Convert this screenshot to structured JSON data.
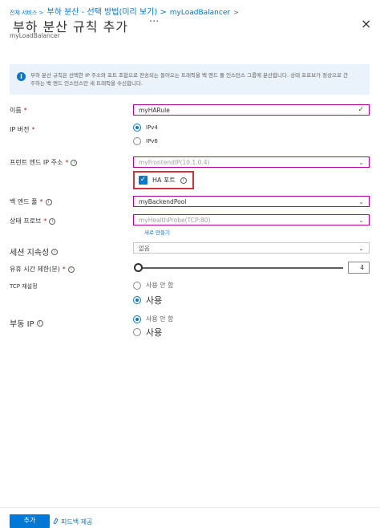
{
  "breadcrumb": {
    "items": [
      "전체 서비스 >",
      "부하 분산 - 선택 방법(미리 보기) >",
      "myLoadBalancer"
    ],
    "trailing_separator": ">"
  },
  "header": {
    "title": "부하 분산 규칙 추가",
    "more_label": "···",
    "close_label": "×",
    "subtitle": "myLoadBalancer"
  },
  "info": {
    "icon": "info-icon",
    "glyph": "i",
    "text": "부하 분산 규칙은 선택한 IP 주소와 포트 조합으로 전송되는 들어오는 트래픽을 백 엔드 풀 인스턴스 그룹에 분산합니다. 상태 프로브가 정상으로 간주하는 백 엔드 인스턴스만 새 트래픽을 수신합니다."
  },
  "form": {
    "name": {
      "label": "이름",
      "required_mark": "*",
      "value": "myHARule",
      "valid_mark": "✓"
    },
    "ip_version": {
      "label": "IP 버전",
      "required_mark": "*",
      "options": [
        "IPv4",
        "IPv6"
      ],
      "selected": "IPv4"
    },
    "frontend_ip": {
      "label": "프런트 엔드 IP 주소",
      "required_mark": "*",
      "help": "i",
      "value": "myFrontendIP(10.1.0.4)"
    },
    "ha_ports": {
      "label": "HA 포트",
      "help": "i",
      "checked": true,
      "check_glyph": "✓"
    },
    "backend_pool": {
      "label": "백 엔드 풀",
      "required_mark": "*",
      "help": "i",
      "value": "myBackendPool"
    },
    "health_probe": {
      "label": "상태 프로브",
      "required_mark": "*",
      "help": "i",
      "value": "myHealthProbe(TCP:80)",
      "create_link": "새로 만들기"
    },
    "session_persistence": {
      "label": "세션 지속성",
      "help": "i",
      "value": "없음"
    },
    "idle_timeout": {
      "label": "유휴 시간 제한(분)",
      "required_mark": "*",
      "help": "i",
      "value": "4",
      "slider_fraction": 0
    },
    "tcp_reset": {
      "label": "TCP 재설정",
      "options": [
        "사용 안 함",
        "사용"
      ],
      "selected": "사용"
    },
    "floating_ip": {
      "label": "부동 IP",
      "help": "i",
      "options": [
        "사용 안 함",
        "사용"
      ],
      "selected": "사용 안 함"
    }
  },
  "footer": {
    "add_label": "추가",
    "feedback_label": "피드백 제공",
    "feedback_icon": "feedback-icon"
  },
  "colors": {
    "accent": "#0078d4",
    "required": "#a4262c",
    "highlight_border": "#d13438",
    "focus_border": "#b4009e",
    "valid": "#107c10",
    "info_bg": "#eaf3fb"
  },
  "chevron": "⌄"
}
